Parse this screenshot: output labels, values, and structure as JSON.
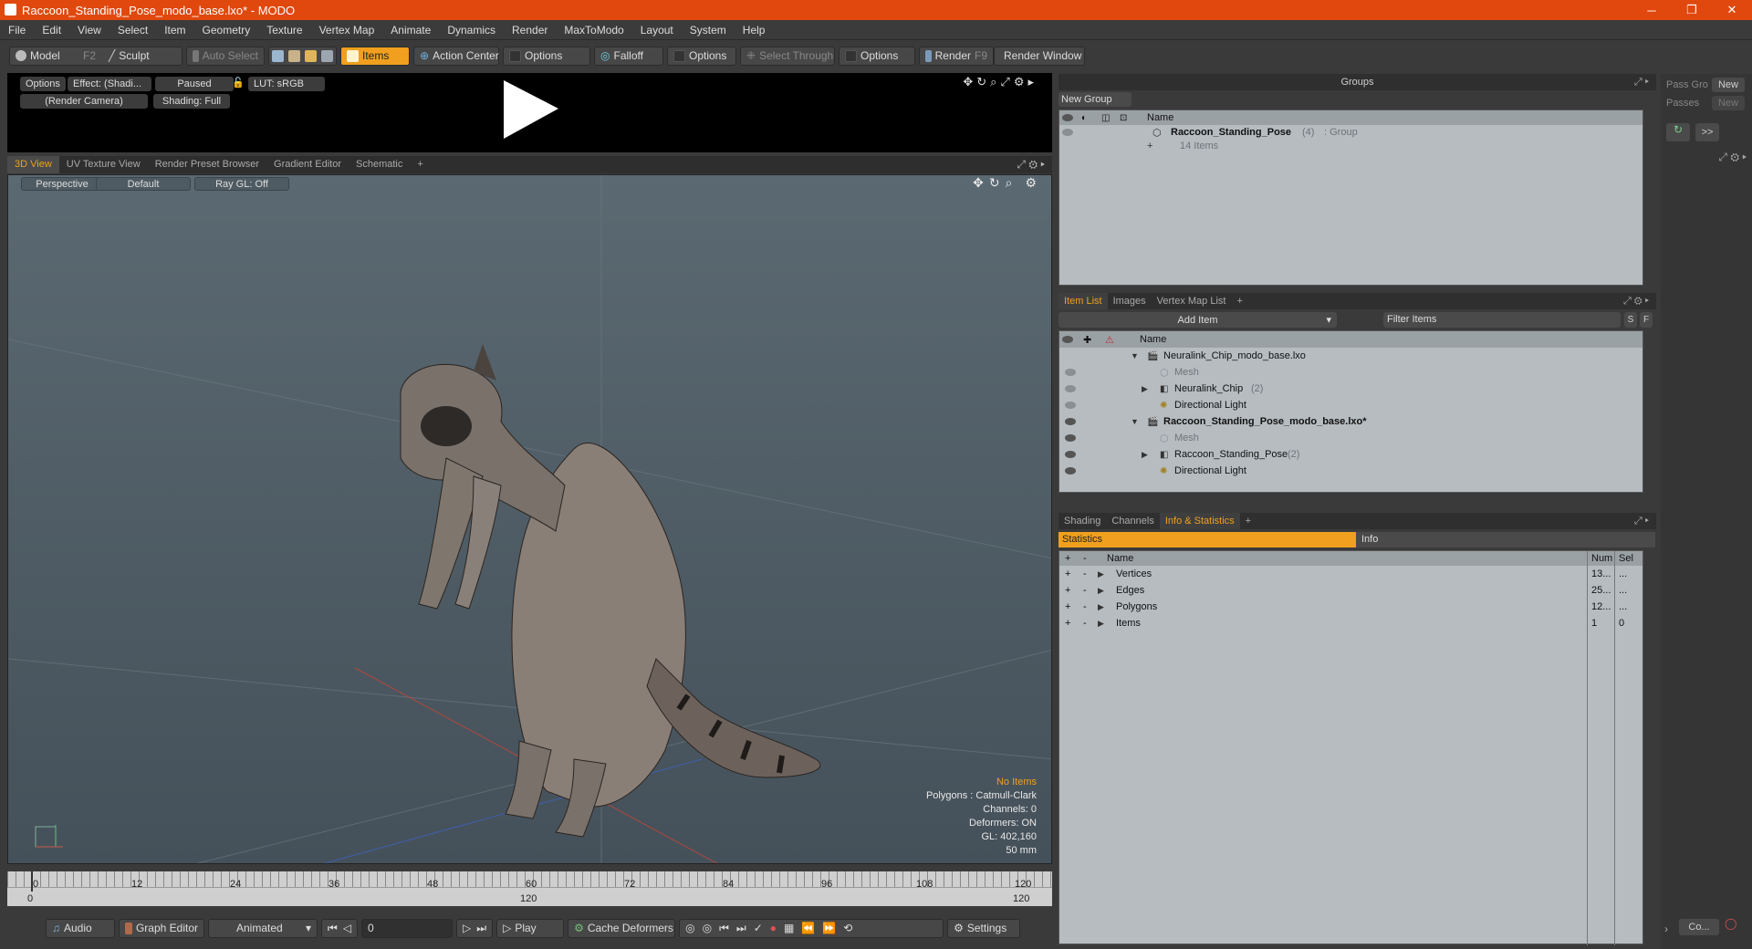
{
  "window": {
    "title": "Raccoon_Standing_Pose_modo_base.lxo* - MODO",
    "minimize": "─",
    "restore": "❐",
    "close": "✕"
  },
  "menu": [
    "File",
    "Edit",
    "View",
    "Select",
    "Item",
    "Geometry",
    "Texture",
    "Vertex Map",
    "Animate",
    "Dynamics",
    "Render",
    "MaxToModo",
    "Layout",
    "System",
    "Help"
  ],
  "toolbar": {
    "model": "Model",
    "model_key": "F2",
    "sculpt": "Sculpt",
    "auto_select": "Auto Select",
    "items": "Items",
    "action_center": "Action Center",
    "options1": "Options",
    "falloff": "Falloff",
    "options2": "Options",
    "select_through": "Select Through",
    "options3": "Options",
    "render": "Render",
    "render_key": "F9",
    "render_window": "Render Window"
  },
  "preview": {
    "options": "Options",
    "effect": "Effect: (Shadi...",
    "paused": "Paused",
    "lut": "LUT: sRGB",
    "camera": "(Render Camera)",
    "shading": "Shading: Full"
  },
  "view_tabs": [
    "3D View",
    "UV Texture View",
    "Render Preset Browser",
    "Gradient Editor",
    "Schematic",
    "+"
  ],
  "viewport": {
    "projection": "Perspective",
    "style": "Default",
    "raygl": "Ray GL: Off"
  },
  "viewport_info": {
    "no_items": "No Items",
    "polygons": "Polygons : Catmull-Clark",
    "channels": "Channels: 0",
    "deformers": "Deformers: ON",
    "gl": "GL: 402,160",
    "lens": "50 mm"
  },
  "timeline": {
    "ticks": [
      "0",
      "12",
      "24",
      "36",
      "48",
      "60",
      "72",
      "84",
      "96",
      "108",
      "120"
    ],
    "start": "0",
    "mid": "120",
    "end": "120"
  },
  "bottom": {
    "audio": "Audio",
    "graph_editor": "Graph Editor",
    "animated": "Animated",
    "frame": "0",
    "play": "Play",
    "cache_deformers": "Cache Deformers",
    "settings": "Settings"
  },
  "groups": {
    "header": "Groups",
    "new_group": "New Group",
    "col_name": "Name",
    "item_name": "Raccoon_Standing_Pose",
    "item_count": "(4)",
    "item_type": ": Group",
    "item_sub": "14 Items"
  },
  "passes": {
    "pass_label": "Pass Gro",
    "passes_label": "Passes",
    "new1": "New",
    "new2": "New",
    "arrow": ">>"
  },
  "item_list": {
    "tabs": [
      "Item List",
      "Images",
      "Vertex Map List",
      "+"
    ],
    "add_item": "Add Item",
    "filter": "Filter Items",
    "s_btn": "S",
    "f_btn": "F",
    "col_name": "Name",
    "rows": [
      {
        "label": "Neuralink_Chip_modo_base.lxo",
        "count": "",
        "style": "scene"
      },
      {
        "label": "Mesh",
        "count": "",
        "style": "mesh"
      },
      {
        "label": "Neuralink_Chip",
        "count": "(2)",
        "style": "group"
      },
      {
        "label": "Directional Light",
        "count": "",
        "style": "light"
      },
      {
        "label": "Raccoon_Standing_Pose_modo_base.lxo*",
        "count": "",
        "style": "scene-bold"
      },
      {
        "label": "Mesh",
        "count": "",
        "style": "mesh"
      },
      {
        "label": "Raccoon_Standing_Pose",
        "count": "(2)",
        "style": "group"
      },
      {
        "label": "Directional Light",
        "count": "",
        "style": "light"
      }
    ]
  },
  "stats": {
    "tabs": [
      "Shading",
      "Channels",
      "Info & Statistics",
      "+"
    ],
    "statistics": "Statistics",
    "info": "Info",
    "col_name": "Name",
    "col_num": "Num",
    "col_sel": "Sel",
    "rows": [
      {
        "name": "Vertices",
        "num": "13...",
        "sel": "..."
      },
      {
        "name": "Edges",
        "num": "25...",
        "sel": "..."
      },
      {
        "name": "Polygons",
        "num": "12...",
        "sel": "..."
      },
      {
        "name": "Items",
        "num": "1",
        "sel": "0"
      }
    ]
  },
  "far_right": {
    "co": "Co..."
  },
  "colors": {
    "accent": "#f0a01e",
    "titlebar": "#e0480e"
  }
}
